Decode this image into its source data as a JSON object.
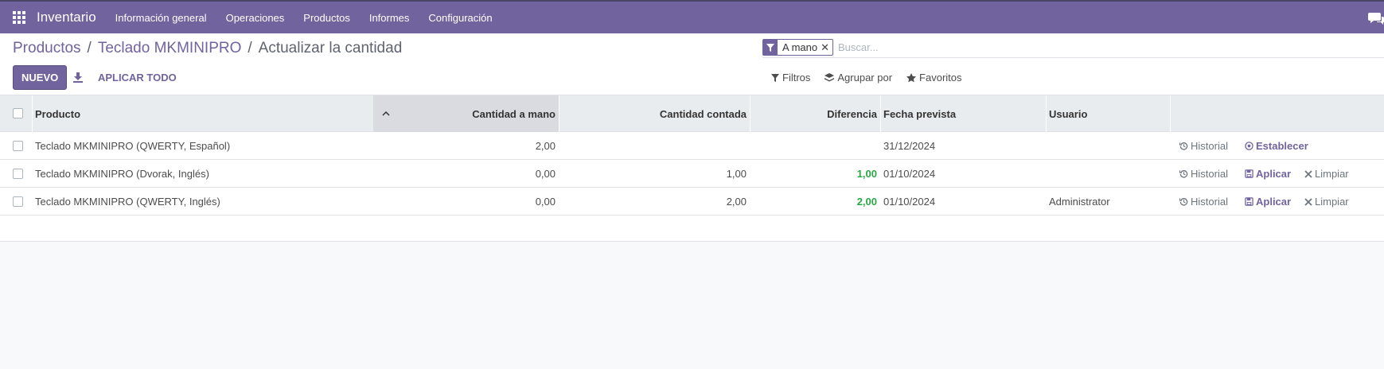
{
  "navbar": {
    "app_name": "Inventario",
    "menu": [
      "Información general",
      "Operaciones",
      "Productos",
      "Informes",
      "Configuración"
    ],
    "bg_color": "#71639e"
  },
  "breadcrumb": {
    "items": [
      "Productos",
      "Teclado MKMINIPRO"
    ],
    "current": "Actualizar la cantidad"
  },
  "toolbar": {
    "new_label": "NUEVO",
    "apply_all_label": "APLICAR TODO"
  },
  "search": {
    "facet_label": "A mano",
    "placeholder": "Buscar..."
  },
  "filters": {
    "filters_label": "Filtros",
    "group_by_label": "Agrupar por",
    "favorites_label": "Favoritos"
  },
  "table": {
    "columns": {
      "product": "Producto",
      "on_hand": "Cantidad a mano",
      "counted": "Cantidad contada",
      "difference": "Diferencia",
      "scheduled": "Fecha prevista",
      "user": "Usuario"
    },
    "rows": [
      {
        "product": "Teclado MKMINIPRO (QWERTY, Español)",
        "on_hand": "2,00",
        "counted": "",
        "difference": "",
        "scheduled": "31/12/2024",
        "user": "",
        "history": "Historial",
        "primary": "Establecer",
        "clear": ""
      },
      {
        "product": "Teclado MKMINIPRO (Dvorak, Inglés)",
        "on_hand": "0,00",
        "counted": "1,00",
        "difference": "1,00",
        "scheduled": "01/10/2024",
        "user": "",
        "history": "Historial",
        "primary": "Aplicar",
        "clear": "Limpiar"
      },
      {
        "product": "Teclado MKMINIPRO (QWERTY, Inglés)",
        "on_hand": "0,00",
        "counted": "2,00",
        "difference": "2,00",
        "scheduled": "01/10/2024",
        "user": "Administrator",
        "history": "Historial",
        "primary": "Aplicar",
        "clear": "Limpiar"
      }
    ]
  }
}
